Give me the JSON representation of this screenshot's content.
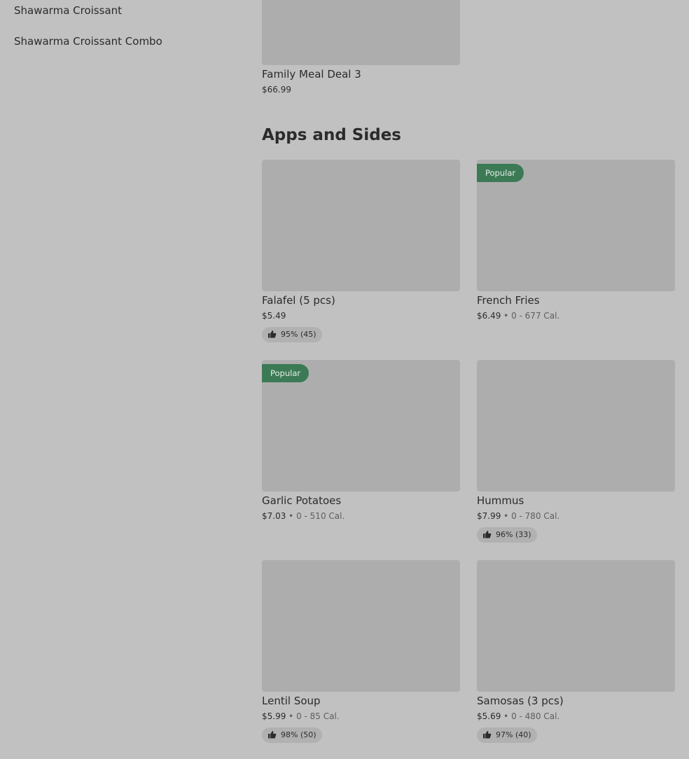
{
  "sidebar": {
    "items": [
      {
        "label": "Shawarma Croissant"
      },
      {
        "label": "Shawarma Croissant Combo"
      }
    ]
  },
  "previous_item": {
    "name": "Family Meal Deal 3",
    "price": "$66.99"
  },
  "section": {
    "title": "Apps and Sides",
    "items": [
      {
        "name": "Falafel (5 pcs)",
        "price": "$5.49",
        "sep": "",
        "calories": "",
        "badge": "",
        "rating": "95% (45)"
      },
      {
        "name": "French Fries",
        "price": "$6.49",
        "sep": " • ",
        "calories": "0 - 677 Cal.",
        "badge": "Popular",
        "rating": ""
      },
      {
        "name": "Garlic Potatoes",
        "price": "$7.03",
        "sep": " • ",
        "calories": "0 - 510 Cal.",
        "badge": "Popular",
        "rating": ""
      },
      {
        "name": "Hummus",
        "price": "$7.99",
        "sep": " • ",
        "calories": "0 - 780 Cal.",
        "badge": "",
        "rating": "96% (33)"
      },
      {
        "name": "Lentil Soup",
        "price": "$5.99",
        "sep": " • ",
        "calories": "0 - 85 Cal.",
        "badge": "",
        "rating": "98% (50)"
      },
      {
        "name": "Samosas (3 pcs)",
        "price": "$5.69",
        "sep": " • ",
        "calories": "0 - 480 Cal.",
        "badge": "",
        "rating": "97% (40)"
      }
    ]
  },
  "colors": {
    "background": "#c1c1c1",
    "image_placeholder": "#adadad",
    "popular_badge": "#3b7a55",
    "rating_pill": "#b1b1b1"
  },
  "icons": {
    "rating": "thumbs-up-icon"
  }
}
